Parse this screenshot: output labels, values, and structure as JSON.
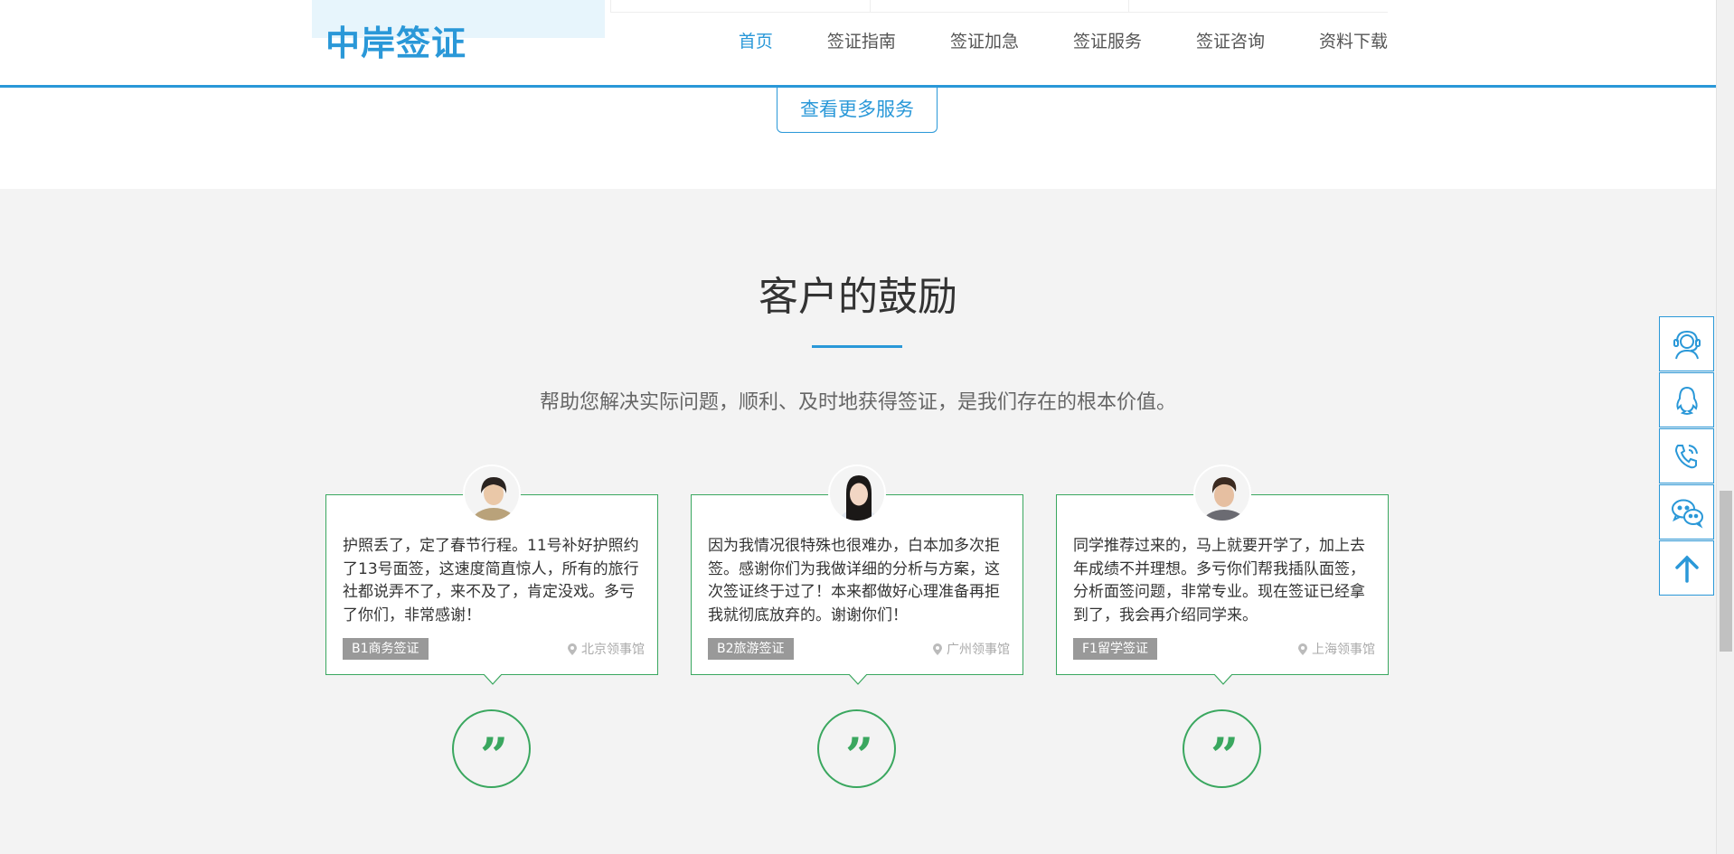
{
  "header": {
    "logo_text": "中岸签证",
    "nav": [
      {
        "label": "首页",
        "active": true
      },
      {
        "label": "签证指南",
        "active": false
      },
      {
        "label": "签证加急",
        "active": false
      },
      {
        "label": "签证服务",
        "active": false
      },
      {
        "label": "签证咨询",
        "active": false
      },
      {
        "label": "资料下载",
        "active": false
      }
    ]
  },
  "more_services": {
    "label": "查看更多服务"
  },
  "testimonials": {
    "title": "客户的鼓励",
    "subtitle": "帮助您解决实际问题，顺利、及时地获得签证，是我们存在的根本价值。",
    "cards": [
      {
        "text": "护照丢了，定了春节行程。11号补好护照约了13号面签，这速度简直惊人，所有的旅行社都说弄不了，来不及了，肯定没戏。多亏了你们，非常感谢！",
        "tag": "B1商务签证",
        "location": "北京领事馆"
      },
      {
        "text": "因为我情况很特殊也很难办，白本加多次拒签。感谢你们为我做详细的分析与方案，这次签证终于过了！本来都做好心理准备再拒我就彻底放弃的。谢谢你们！",
        "tag": "B2旅游签证",
        "location": "广州领事馆"
      },
      {
        "text": "同学推荐过来的，马上就要开学了，加上去年成绩不并理想。多亏你们帮我插队面签，分析面签问题，非常专业。现在签证已经拿到了，我会再介绍同学来。",
        "tag": "F1留学签证",
        "location": "上海领事馆"
      }
    ],
    "quote_glyph": "”"
  },
  "side_tools": [
    "headset-icon",
    "qq-icon",
    "phone-icon",
    "wechat-icon",
    "arrow-up-icon"
  ],
  "colors": {
    "accent": "#2a98d8",
    "green": "#3aa75f",
    "logo_orange": "#f08c1f"
  }
}
